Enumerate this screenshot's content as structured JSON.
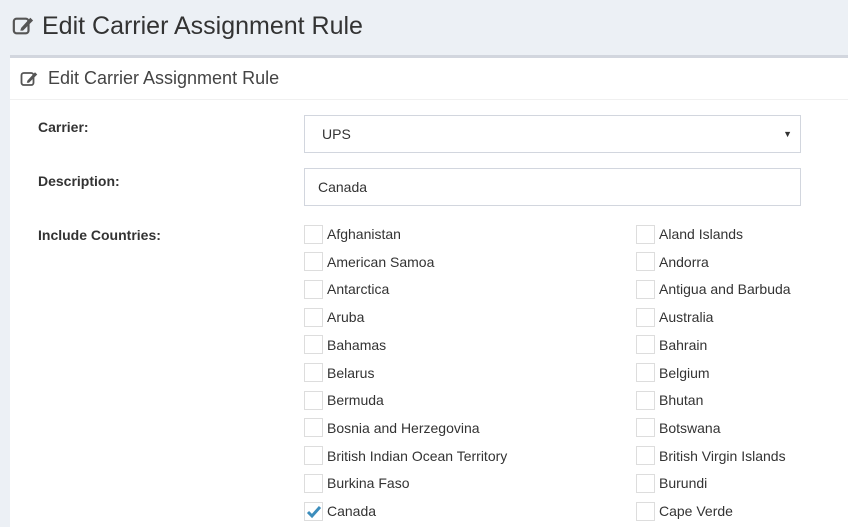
{
  "page": {
    "title": "Edit Carrier Assignment Rule"
  },
  "panel": {
    "title": "Edit Carrier Assignment Rule"
  },
  "form": {
    "carrier_label": "Carrier:",
    "carrier_value": "UPS",
    "description_label": "Description:",
    "description_value": "Canada",
    "include_countries_label": "Include Countries:"
  },
  "countries_left": [
    {
      "name": "Afghanistan",
      "checked": false
    },
    {
      "name": "American Samoa",
      "checked": false
    },
    {
      "name": "Antarctica",
      "checked": false
    },
    {
      "name": "Aruba",
      "checked": false
    },
    {
      "name": "Bahamas",
      "checked": false
    },
    {
      "name": "Belarus",
      "checked": false
    },
    {
      "name": "Bermuda",
      "checked": false
    },
    {
      "name": "Bosnia and Herzegovina",
      "checked": false
    },
    {
      "name": "British Indian Ocean Territory",
      "checked": false
    },
    {
      "name": "Burkina Faso",
      "checked": false
    },
    {
      "name": "Canada",
      "checked": true
    }
  ],
  "countries_right": [
    {
      "name": "Aland Islands",
      "checked": false
    },
    {
      "name": "Andorra",
      "checked": false
    },
    {
      "name": "Antigua and Barbuda",
      "checked": false
    },
    {
      "name": "Australia",
      "checked": false
    },
    {
      "name": "Bahrain",
      "checked": false
    },
    {
      "name": "Belgium",
      "checked": false
    },
    {
      "name": "Bhutan",
      "checked": false
    },
    {
      "name": "Botswana",
      "checked": false
    },
    {
      "name": "British Virgin Islands",
      "checked": false
    },
    {
      "name": "Burundi",
      "checked": false
    },
    {
      "name": "Cape Verde",
      "checked": false
    }
  ],
  "icons": {
    "edit": "edit-icon",
    "dropdown": "caret-down-icon",
    "check": "checkmark-icon"
  },
  "colors": {
    "background": "#ecf0f5",
    "check": "#3c8dbc"
  }
}
